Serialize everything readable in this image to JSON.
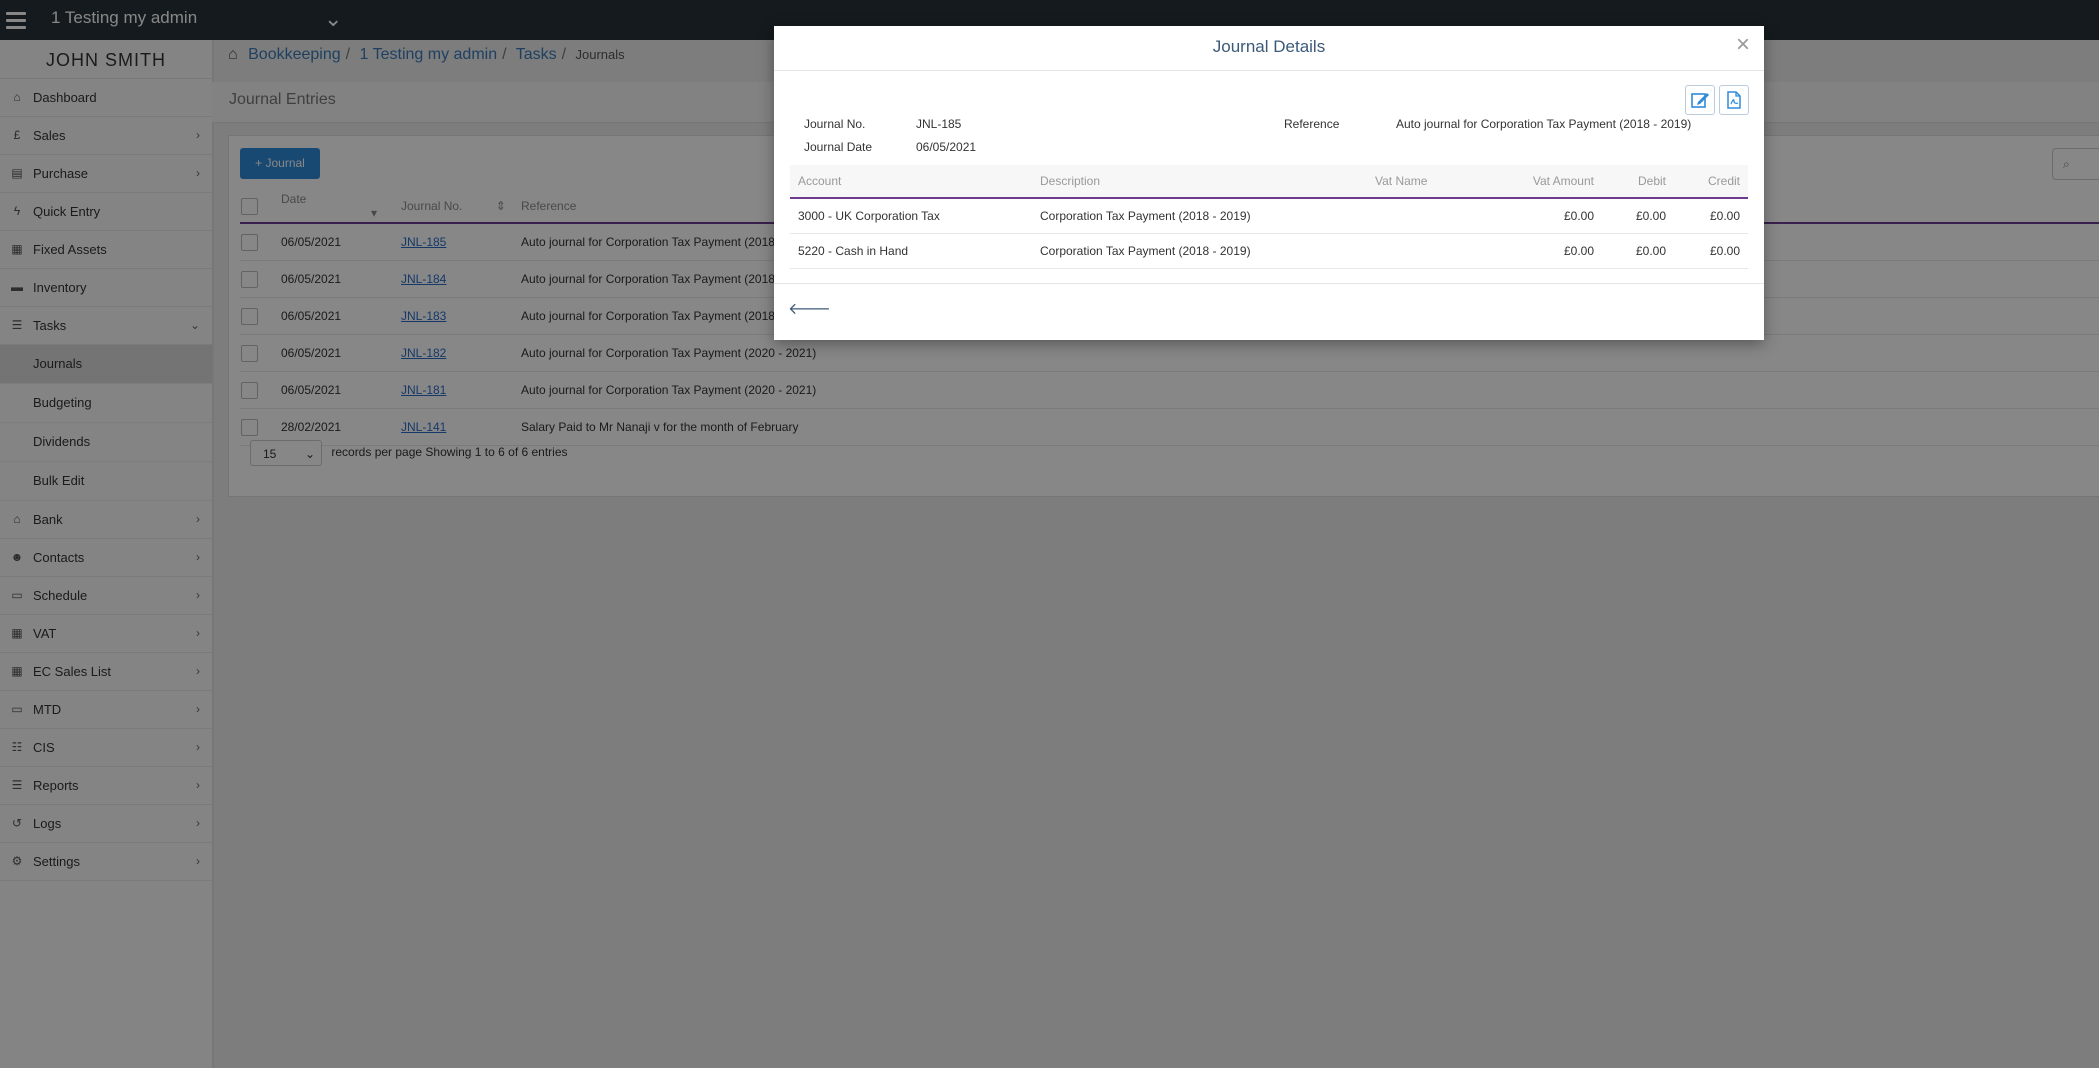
{
  "topbar": {
    "company": "1 Testing my admin"
  },
  "sidebar": {
    "user": "JOHN SMITH",
    "items": [
      {
        "label": "Dashboard",
        "icon": "home-icon"
      },
      {
        "label": "Sales",
        "icon": "pound-icon"
      },
      {
        "label": "Purchase",
        "icon": "receipt-icon"
      },
      {
        "label": "Quick Entry",
        "icon": "bolt-icon"
      },
      {
        "label": "Fixed Assets",
        "icon": "building-icon"
      },
      {
        "label": "Inventory",
        "icon": "truck-icon"
      },
      {
        "label": "Tasks",
        "icon": "tasks-icon"
      }
    ],
    "subitems": [
      "Journals",
      "Budgeting",
      "Dividends",
      "Bulk Edit"
    ],
    "items2": [
      {
        "label": "Bank",
        "icon": "bank-icon"
      },
      {
        "label": "Contacts",
        "icon": "users-icon"
      },
      {
        "label": "Schedule",
        "icon": "calendar-icon"
      },
      {
        "label": "VAT",
        "icon": "calculator-icon"
      },
      {
        "label": "EC Sales List",
        "icon": "calculator-icon"
      },
      {
        "label": "MTD",
        "icon": "calendar-icon"
      },
      {
        "label": "CIS",
        "icon": "list-icon"
      },
      {
        "label": "Reports",
        "icon": "list-icon"
      },
      {
        "label": "Logs",
        "icon": "history-icon"
      },
      {
        "label": "Settings",
        "icon": "gears-icon"
      }
    ]
  },
  "breadcrumb": {
    "b1": "Bookkeeping",
    "b2": "1 Testing my admin",
    "b3": "Tasks",
    "b4": "Journals"
  },
  "page": {
    "title": "Journal Entries",
    "add_button": "Journal",
    "columns": {
      "date": "Date",
      "journal_no": "Journal No.",
      "reference": "Reference"
    },
    "rows": [
      {
        "date": "06/05/2021",
        "no": "JNL-185",
        "ref": "Auto journal for Corporation Tax Payment (2018 - 2019)"
      },
      {
        "date": "06/05/2021",
        "no": "JNL-184",
        "ref": "Auto journal for Corporation Tax Payment (2018 - 2019)"
      },
      {
        "date": "06/05/2021",
        "no": "JNL-183",
        "ref": "Auto journal for Corporation Tax Payment (2018 - 2019)"
      },
      {
        "date": "06/05/2021",
        "no": "JNL-182",
        "ref": "Auto journal for Corporation Tax Payment (2020 - 2021)"
      },
      {
        "date": "06/05/2021",
        "no": "JNL-181",
        "ref": "Auto journal for Corporation Tax Payment (2020 - 2021)"
      },
      {
        "date": "28/02/2021",
        "no": "JNL-141",
        "ref": "Salary Paid to Mr Nanaji v for the month of February"
      }
    ],
    "per_page": "15",
    "per_page_label": "records per page",
    "showing": "Showing 1 to 6 of 6 entries"
  },
  "modal": {
    "title": "Journal Details",
    "close": "×",
    "journal_no_label": "Journal No.",
    "journal_no": "JNL-185",
    "journal_date_label": "Journal Date",
    "journal_date": "06/05/2021",
    "reference_label": "Reference",
    "reference": "Auto journal for Corporation Tax Payment (2018 - 2019)",
    "columns": {
      "account": "Account",
      "description": "Description",
      "vat_name": "Vat Name",
      "vat_amount": "Vat Amount",
      "debit": "Debit",
      "credit": "Credit"
    },
    "lines": [
      {
        "account": "3000 - UK Corporation Tax",
        "description": "Corporation Tax Payment (2018 - 2019)",
        "vat_name": "",
        "vat_amount": "£0.00",
        "debit": "£0.00",
        "credit": "£0.00"
      },
      {
        "account": "5220 - Cash in Hand",
        "description": "Corporation Tax Payment (2018 - 2019)",
        "vat_name": "",
        "vat_amount": "£0.00",
        "debit": "£0.00",
        "credit": "£0.00"
      }
    ]
  }
}
